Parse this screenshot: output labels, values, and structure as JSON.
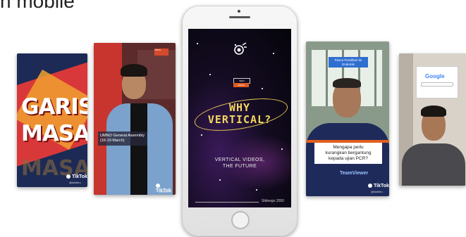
{
  "heading": "n mobile",
  "cards": {
    "garis_masa": {
      "line1": "GARIS",
      "line2": "MASA",
      "ghost": "MASA",
      "tiktok": "TikTok",
      "handle": "@kinibiru"
    },
    "umno": {
      "sign": "UMNO",
      "caption_line1": "UMNO General Assembly",
      "caption_line2": "(16-19 March)",
      "tiktok": "TikTok",
      "handle": "@kinibiru"
    },
    "phone": {
      "tag_top": "WHO",
      "tag_bottom": "AWANI",
      "title_line1": "WHY",
      "title_line2": "VERTICAL?",
      "sub_line1": "VERTICAL VIDEOS,",
      "sub_line2": "THE FUTURE",
      "credit": "Slideego 2050"
    },
    "pcr": {
      "label_line1": "Pasca Peralihan ke",
      "label_line2": "Endemik",
      "question_line1": "Mengapa perlu",
      "question_line2": "kurangkan bergantung",
      "question_line3": "kepada ujian PCR?",
      "brand": "TeamViewer",
      "tiktok": "TikTok",
      "handle": "@kinibiru"
    },
    "google": {
      "search_brand": "Google"
    }
  },
  "colors": {
    "title_yellow": "#f4d760",
    "card_red": "#d9383a",
    "caption_blue": "#2f6fd0"
  }
}
